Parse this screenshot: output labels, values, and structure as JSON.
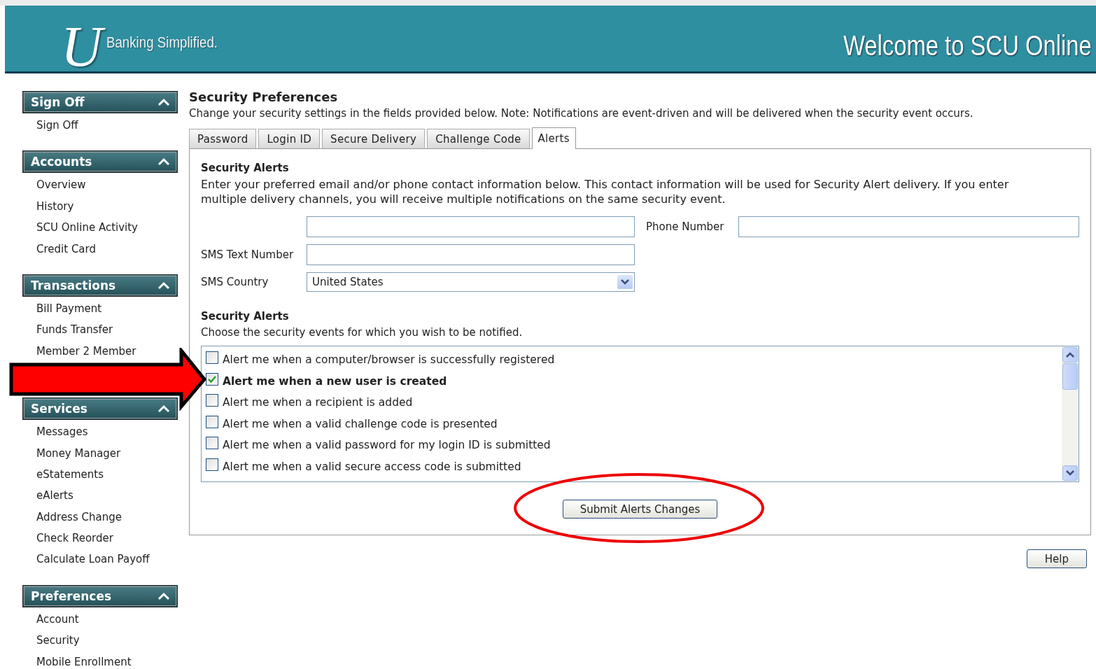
{
  "header": {
    "logo_letter": "U",
    "tagline": "Banking Simplified.",
    "welcome": "Welcome to SCU Online"
  },
  "sidebar": {
    "sections": [
      {
        "title": "Sign Off",
        "expanded": true,
        "items": [
          "Sign Off"
        ]
      },
      {
        "title": "Accounts",
        "expanded": true,
        "items": [
          "Overview",
          "History",
          "SCU Online Activity",
          "Credit Card"
        ]
      },
      {
        "title": "Transactions",
        "expanded": true,
        "items": [
          "Bill Payment",
          "Funds Transfer",
          "Member 2 Member"
        ]
      },
      {
        "title": "Services",
        "expanded": true,
        "items": [
          "Messages",
          "Money Manager",
          "eStatements",
          "eAlerts",
          "Address Change",
          "Check Reorder",
          "Calculate Loan Payoff"
        ]
      },
      {
        "title": "Preferences",
        "expanded": true,
        "items": [
          "Account",
          "Security",
          "Mobile Enrollment"
        ]
      }
    ]
  },
  "page": {
    "title": "Security Preferences",
    "description": "Change your security settings in the fields provided below. Note: Notifications are event-driven and will be delivered when the security event occurs.",
    "tabs": [
      {
        "label": "Password",
        "selected": false
      },
      {
        "label": "Login ID",
        "selected": false
      },
      {
        "label": "Secure Delivery",
        "selected": false
      },
      {
        "label": "Challenge Code",
        "selected": false
      },
      {
        "label": "Alerts",
        "selected": true
      }
    ],
    "panel": {
      "heading": "Security Alerts",
      "intro": "Enter your preferred email and/or phone contact information below. This contact information will be used for Security Alert delivery. If you enter multiple delivery channels, you will receive multiple notifications on the same security event.",
      "phone_label": "Phone Number",
      "sms_label": "SMS Text Number",
      "country_label": "SMS Country",
      "country_value": "United States",
      "alerts_heading": "Security Alerts",
      "alerts_intro": "Choose the security events for which you wish to be notified.",
      "alerts": [
        {
          "label": "Alert me when a computer/browser is successfully registered",
          "checked": false
        },
        {
          "label": "Alert me when a new user is created",
          "checked": true
        },
        {
          "label": "Alert me when a recipient is added",
          "checked": false
        },
        {
          "label": "Alert me when a valid challenge code is presented",
          "checked": false
        },
        {
          "label": "Alert me when a valid password for my login ID is submitted",
          "checked": false
        },
        {
          "label": "Alert me when a valid secure access code is submitted",
          "checked": false
        }
      ],
      "submit": "Submit Alerts Changes"
    },
    "help": "Help"
  }
}
